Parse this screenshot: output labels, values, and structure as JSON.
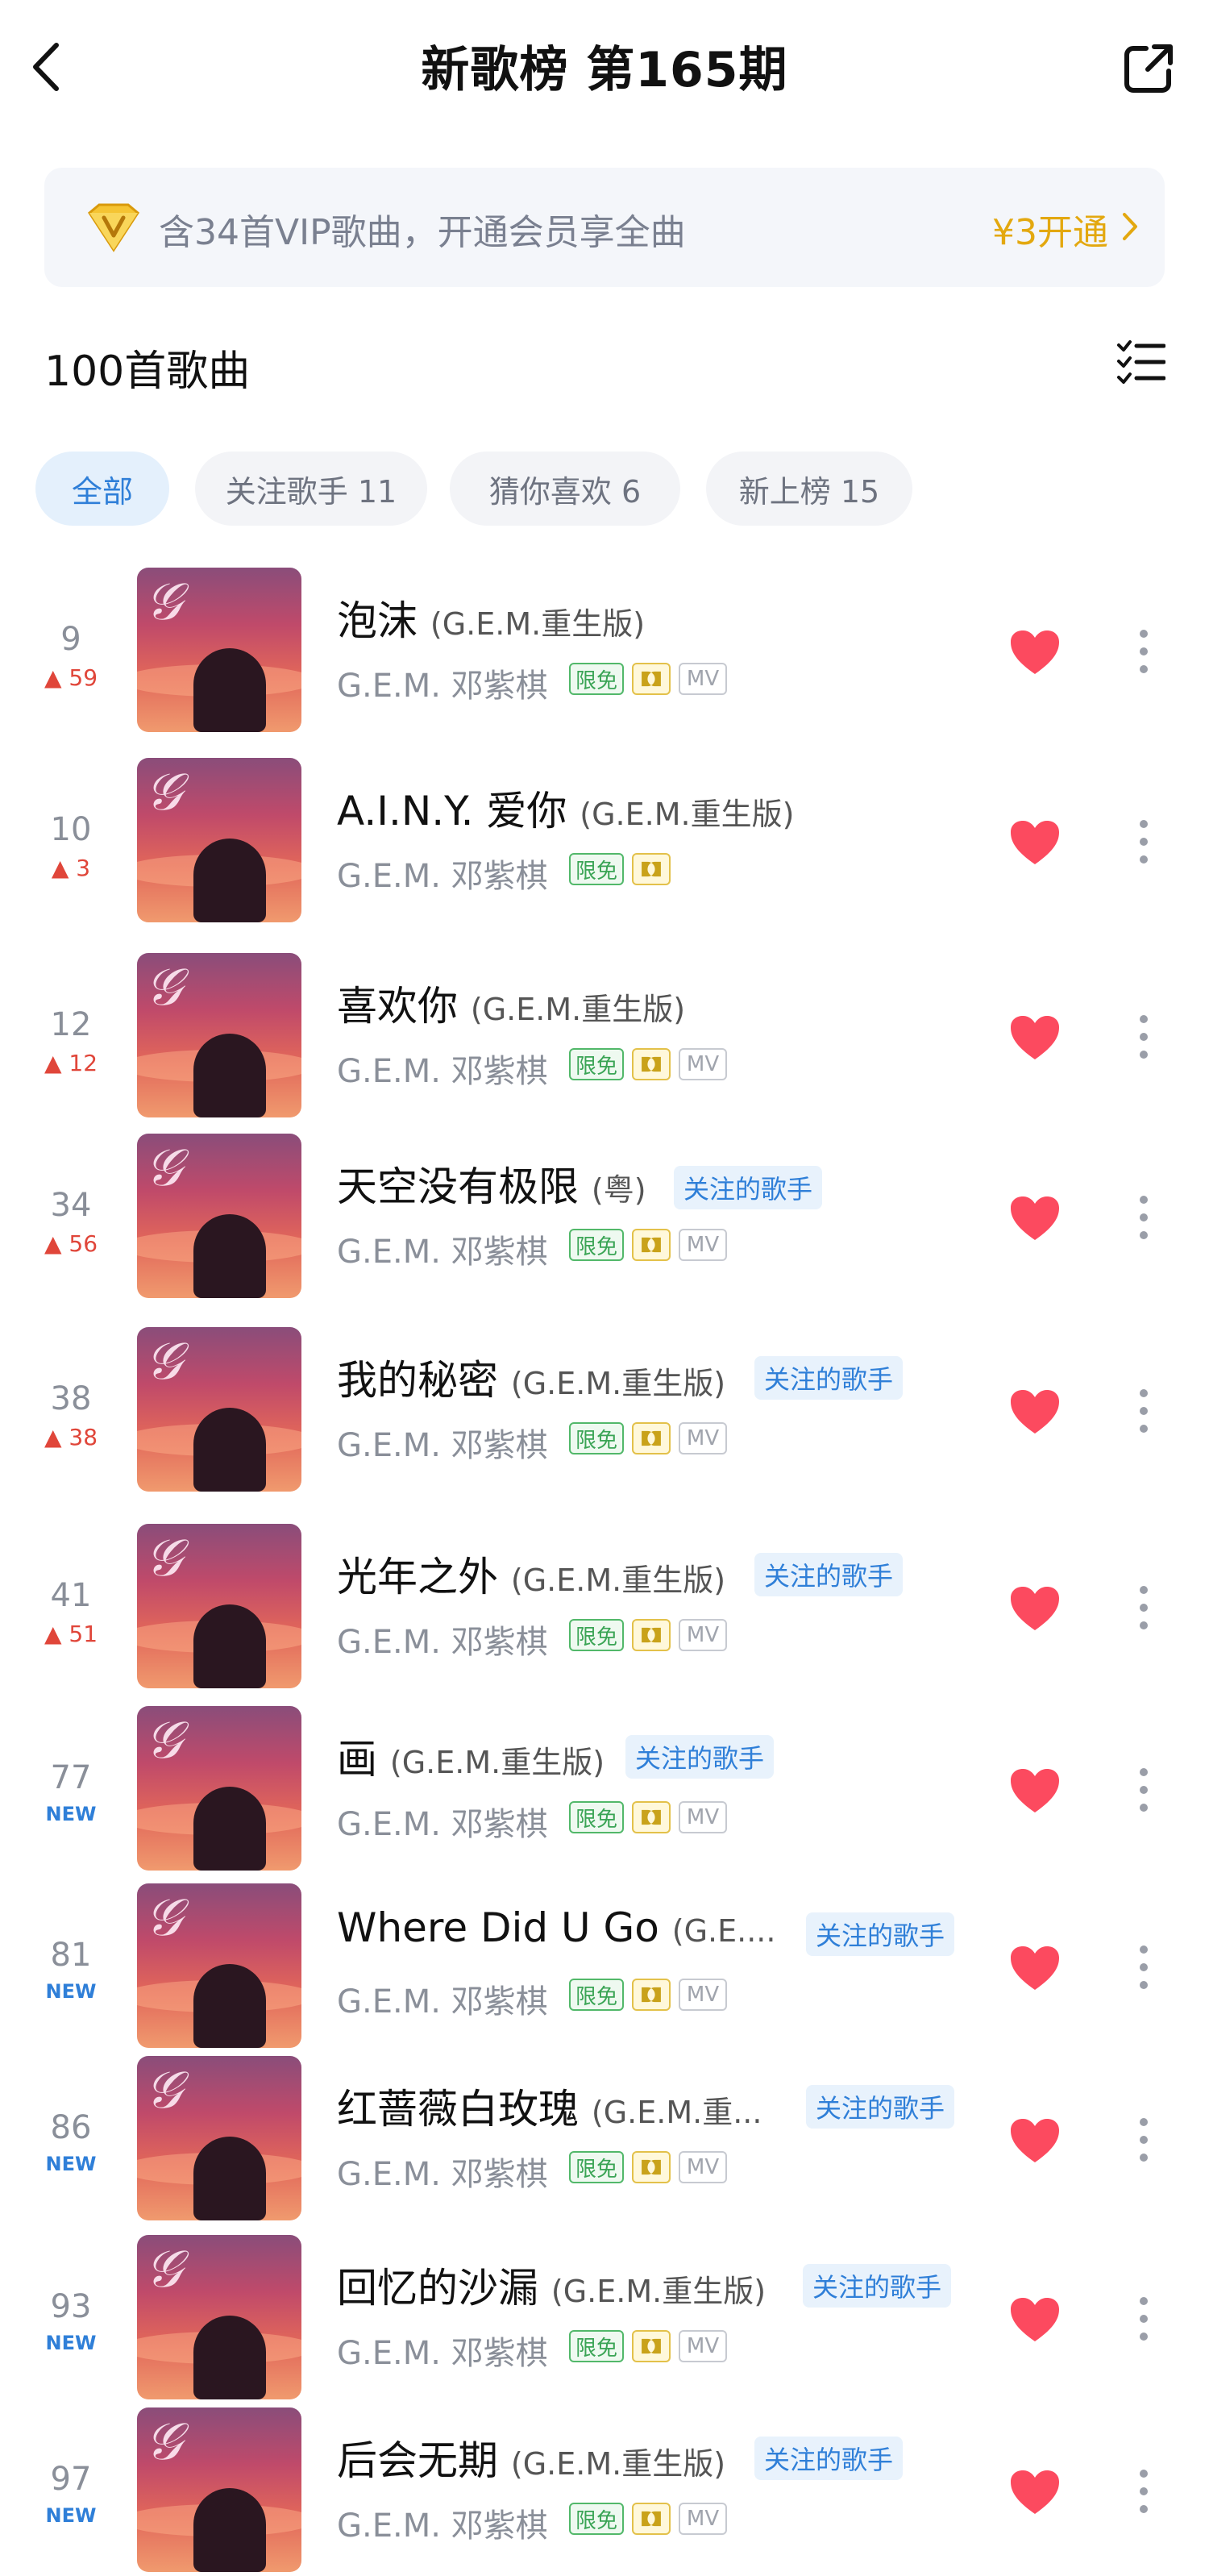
{
  "header": {
    "title": "新歌榜 第165期"
  },
  "vip_banner": {
    "text": "含34首VIP歌曲，开通会员享全曲",
    "price": "¥3开通",
    "accent_color": "#e3a80f"
  },
  "list_header": {
    "count": "100首歌曲"
  },
  "filters": [
    {
      "label": "全部",
      "active": true
    },
    {
      "label": "关注歌手 11",
      "active": false
    },
    {
      "label": "猜你喜欢 6",
      "active": false
    },
    {
      "label": "新上榜 15",
      "active": false
    }
  ],
  "badge_labels": {
    "free": "限免",
    "mv": "MV",
    "follow": "关注的歌手"
  },
  "songs": [
    {
      "rank": "9",
      "change": "59",
      "title": "泡沫",
      "version": "(G.E.M.重生版)",
      "artist": "G.E.M. 邓紫棋",
      "followed": false,
      "mv": true,
      "liked": true
    },
    {
      "rank": "10",
      "change": "3",
      "title": "A.I.N.Y. 爱你",
      "version": "(G.E.M.重生版)",
      "artist": "G.E.M. 邓紫棋",
      "followed": false,
      "mv": false,
      "liked": true
    },
    {
      "rank": "12",
      "change": "12",
      "title": "喜欢你",
      "version": "(G.E.M.重生版)",
      "artist": "G.E.M. 邓紫棋",
      "followed": false,
      "mv": true,
      "liked": true
    },
    {
      "rank": "34",
      "change": "56",
      "title": "天空没有极限",
      "version": "(粤)",
      "artist": "G.E.M. 邓紫棋",
      "followed": true,
      "mv": true,
      "liked": true
    },
    {
      "rank": "38",
      "change": "38",
      "title": "我的秘密",
      "version": "(G.E.M.重生版)",
      "artist": "G.E.M. 邓紫棋",
      "followed": true,
      "mv": true,
      "liked": true
    },
    {
      "rank": "41",
      "change": "51",
      "title": "光年之外",
      "version": "(G.E.M.重生版)",
      "artist": "G.E.M. 邓紫棋",
      "followed": true,
      "mv": true,
      "liked": true
    },
    {
      "rank": "77",
      "change": "NEW",
      "title": "画",
      "version": "(G.E.M.重生版)",
      "artist": "G.E.M. 邓紫棋",
      "followed": true,
      "mv": true,
      "liked": true
    },
    {
      "rank": "81",
      "change": "NEW",
      "title": "Where Did U Go",
      "version": "(G.E....",
      "artist": "G.E.M. 邓紫棋",
      "followed": true,
      "mv": true,
      "liked": true
    },
    {
      "rank": "86",
      "change": "NEW",
      "title": "红蔷薇白玫瑰",
      "version": "(G.E.M.重...",
      "artist": "G.E.M. 邓紫棋",
      "followed": true,
      "mv": true,
      "liked": true
    },
    {
      "rank": "93",
      "change": "NEW",
      "title": "回忆的沙漏",
      "version": "(G.E.M.重生版)",
      "artist": "G.E.M. 邓紫棋",
      "followed": true,
      "mv": true,
      "liked": true
    },
    {
      "rank": "97",
      "change": "NEW",
      "title": "后会无期",
      "version": "(G.E.M.重生版)",
      "artist": "G.E.M. 邓紫棋",
      "followed": true,
      "mv": true,
      "liked": true
    }
  ],
  "colors": {
    "heart": "#fc4a5f",
    "rank_up": "#e0463a",
    "new": "#2f7fd8",
    "follow_tag": "#2f7fd8"
  }
}
